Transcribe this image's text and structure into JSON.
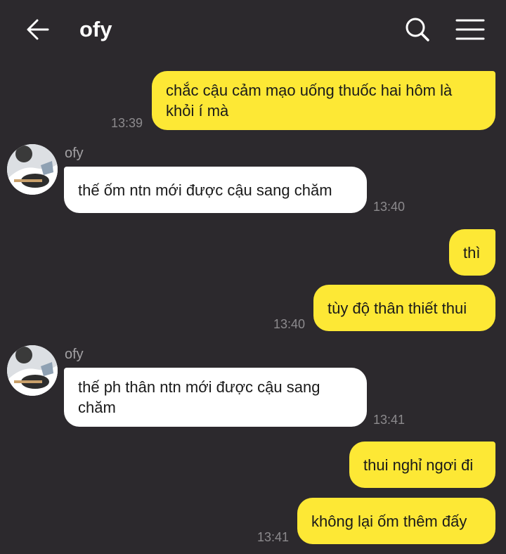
{
  "header": {
    "title": "ofy",
    "back_icon": "back-arrow-icon",
    "search_icon": "search-icon",
    "menu_icon": "menu-icon"
  },
  "colors": {
    "background": "#2c292d",
    "outgoing_bubble": "#fde835",
    "incoming_bubble": "#ffffff",
    "timestamp": "#8c8a8d"
  },
  "messages": [
    {
      "direction": "outgoing",
      "text": "chắc cậu cảm mạo uống thuốc hai hôm là khỏi í mà",
      "time": "13:39"
    },
    {
      "direction": "incoming",
      "sender": "ofy",
      "text": "thế ốm ntn mới được cậu sang chăm",
      "time": "13:40"
    },
    {
      "direction": "outgoing",
      "text": "thì",
      "time": ""
    },
    {
      "direction": "outgoing",
      "text": "tùy độ thân thiết thui",
      "time": "13:40"
    },
    {
      "direction": "incoming",
      "sender": "ofy",
      "text": "thế ph thân ntn mới được cậu sang chăm",
      "time": "13:41"
    },
    {
      "direction": "outgoing",
      "text": "thui nghỉ ngơi đi",
      "time": ""
    },
    {
      "direction": "outgoing",
      "text": "không lại ốm thêm đấy",
      "time": "13:41"
    }
  ]
}
